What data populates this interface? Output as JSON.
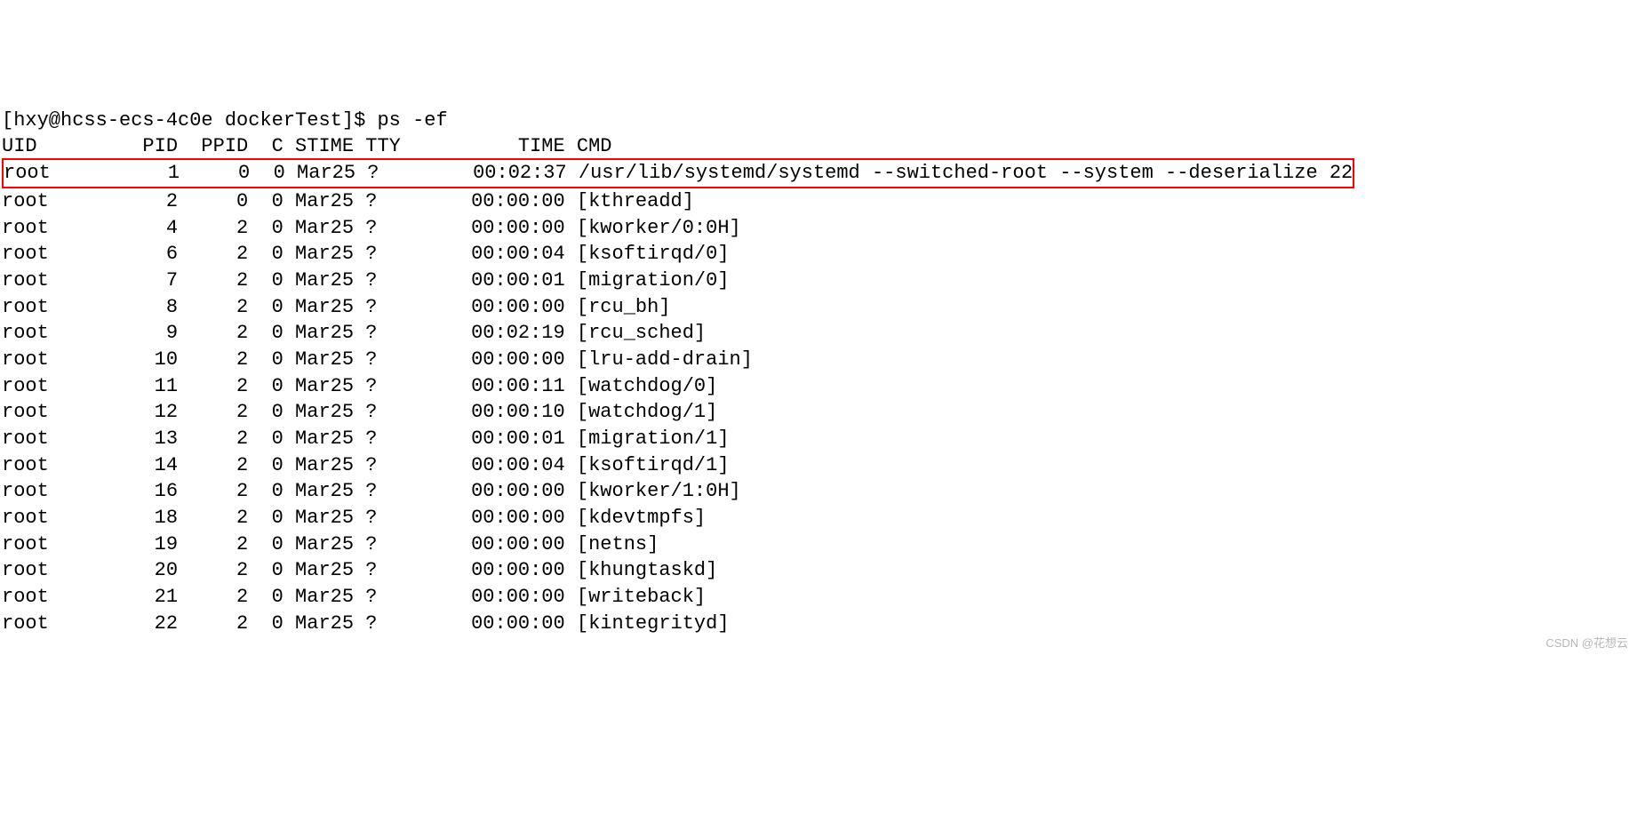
{
  "prompt_line": "[hxy@hcss-ecs-4c0e dockerTest]$ ps -ef",
  "header": {
    "uid": "UID",
    "pid": "PID",
    "ppid": "PPID",
    "c": "C",
    "stime": "STIME",
    "tty": "TTY",
    "time": "TIME",
    "cmd": "CMD"
  },
  "rows": [
    {
      "uid": "root",
      "pid": "1",
      "ppid": "0",
      "c": "0",
      "stime": "Mar25",
      "tty": "?",
      "time": "00:02:37",
      "cmd": "/usr/lib/systemd/systemd --switched-root --system --deserialize 22",
      "hl": true
    },
    {
      "uid": "root",
      "pid": "2",
      "ppid": "0",
      "c": "0",
      "stime": "Mar25",
      "tty": "?",
      "time": "00:00:00",
      "cmd": "[kthreadd]"
    },
    {
      "uid": "root",
      "pid": "4",
      "ppid": "2",
      "c": "0",
      "stime": "Mar25",
      "tty": "?",
      "time": "00:00:00",
      "cmd": "[kworker/0:0H]"
    },
    {
      "uid": "root",
      "pid": "6",
      "ppid": "2",
      "c": "0",
      "stime": "Mar25",
      "tty": "?",
      "time": "00:00:04",
      "cmd": "[ksoftirqd/0]"
    },
    {
      "uid": "root",
      "pid": "7",
      "ppid": "2",
      "c": "0",
      "stime": "Mar25",
      "tty": "?",
      "time": "00:00:01",
      "cmd": "[migration/0]"
    },
    {
      "uid": "root",
      "pid": "8",
      "ppid": "2",
      "c": "0",
      "stime": "Mar25",
      "tty": "?",
      "time": "00:00:00",
      "cmd": "[rcu_bh]"
    },
    {
      "uid": "root",
      "pid": "9",
      "ppid": "2",
      "c": "0",
      "stime": "Mar25",
      "tty": "?",
      "time": "00:02:19",
      "cmd": "[rcu_sched]"
    },
    {
      "uid": "root",
      "pid": "10",
      "ppid": "2",
      "c": "0",
      "stime": "Mar25",
      "tty": "?",
      "time": "00:00:00",
      "cmd": "[lru-add-drain]"
    },
    {
      "uid": "root",
      "pid": "11",
      "ppid": "2",
      "c": "0",
      "stime": "Mar25",
      "tty": "?",
      "time": "00:00:11",
      "cmd": "[watchdog/0]"
    },
    {
      "uid": "root",
      "pid": "12",
      "ppid": "2",
      "c": "0",
      "stime": "Mar25",
      "tty": "?",
      "time": "00:00:10",
      "cmd": "[watchdog/1]"
    },
    {
      "uid": "root",
      "pid": "13",
      "ppid": "2",
      "c": "0",
      "stime": "Mar25",
      "tty": "?",
      "time": "00:00:01",
      "cmd": "[migration/1]"
    },
    {
      "uid": "root",
      "pid": "14",
      "ppid": "2",
      "c": "0",
      "stime": "Mar25",
      "tty": "?",
      "time": "00:00:04",
      "cmd": "[ksoftirqd/1]"
    },
    {
      "uid": "root",
      "pid": "16",
      "ppid": "2",
      "c": "0",
      "stime": "Mar25",
      "tty": "?",
      "time": "00:00:00",
      "cmd": "[kworker/1:0H]"
    },
    {
      "uid": "root",
      "pid": "18",
      "ppid": "2",
      "c": "0",
      "stime": "Mar25",
      "tty": "?",
      "time": "00:00:00",
      "cmd": "[kdevtmpfs]"
    },
    {
      "uid": "root",
      "pid": "19",
      "ppid": "2",
      "c": "0",
      "stime": "Mar25",
      "tty": "?",
      "time": "00:00:00",
      "cmd": "[netns]"
    },
    {
      "uid": "root",
      "pid": "20",
      "ppid": "2",
      "c": "0",
      "stime": "Mar25",
      "tty": "?",
      "time": "00:00:00",
      "cmd": "[khungtaskd]"
    },
    {
      "uid": "root",
      "pid": "21",
      "ppid": "2",
      "c": "0",
      "stime": "Mar25",
      "tty": "?",
      "time": "00:00:00",
      "cmd": "[writeback]"
    },
    {
      "uid": "root",
      "pid": "22",
      "ppid": "2",
      "c": "0",
      "stime": "Mar25",
      "tty": "?",
      "time": "00:00:00",
      "cmd": "[kintegrityd]"
    }
  ],
  "watermark": "CSDN @花想云"
}
